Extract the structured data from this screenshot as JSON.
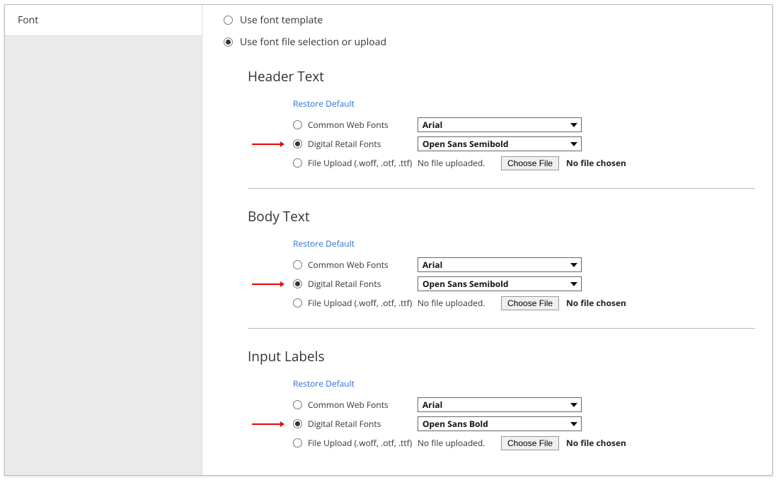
{
  "sidebar": {
    "tab_label": "Font"
  },
  "top_options": {
    "template_label": "Use font template",
    "file_label": "Use font file selection or upload",
    "selected": "file"
  },
  "sections": [
    {
      "title": "Header Text",
      "restore_label": "Restore Default",
      "rows": {
        "common": {
          "label": "Common Web Fonts",
          "select_value": "Arial"
        },
        "digital": {
          "label": "Digital Retail Fonts",
          "select_value": "Open Sans Semibold",
          "checked": true
        },
        "upload": {
          "label": "File Upload (.woff, .otf, .ttf)",
          "status": "No file uploaded.",
          "button": "Choose File",
          "chosen": "No file chosen"
        }
      }
    },
    {
      "title": "Body Text",
      "restore_label": "Restore Default",
      "rows": {
        "common": {
          "label": "Common Web Fonts",
          "select_value": "Arial"
        },
        "digital": {
          "label": "Digital Retail Fonts",
          "select_value": "Open Sans Semibold",
          "checked": true
        },
        "upload": {
          "label": "File Upload (.woff, .otf, .ttf)",
          "status": "No file uploaded.",
          "button": "Choose File",
          "chosen": "No file chosen"
        }
      }
    },
    {
      "title": "Input Labels",
      "restore_label": "Restore Default",
      "rows": {
        "common": {
          "label": "Common Web Fonts",
          "select_value": "Arial"
        },
        "digital": {
          "label": "Digital Retail Fonts",
          "select_value": "Open Sans Bold",
          "checked": true
        },
        "upload": {
          "label": "File Upload (.woff, .otf, .ttf)",
          "status": "No file uploaded.",
          "button": "Choose File",
          "chosen": "No file chosen"
        }
      }
    }
  ]
}
